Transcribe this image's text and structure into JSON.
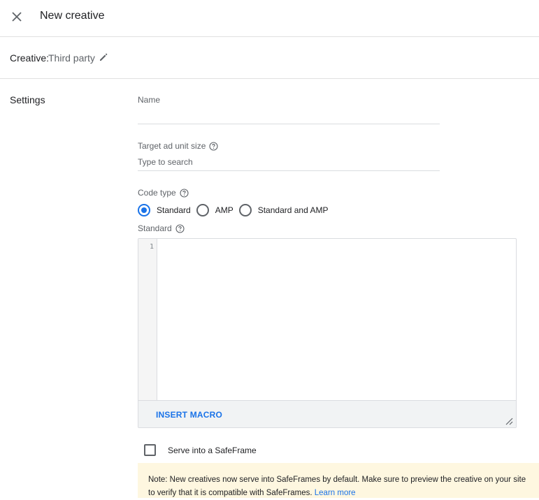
{
  "header": {
    "title": "New creative",
    "close_icon": "close-icon"
  },
  "creative": {
    "label": "Creative:",
    "type": "Third party",
    "edit_icon": "pencil-icon"
  },
  "settings": {
    "section_title": "Settings",
    "name": {
      "label": "Name",
      "value": "",
      "placeholder": ""
    },
    "target_size": {
      "label": "Target ad unit size",
      "value": "",
      "placeholder": "Type to search",
      "help_icon": "help-circle-icon"
    },
    "code_type": {
      "label": "Code type",
      "help_icon": "help-circle-icon",
      "options": [
        "Standard",
        "AMP",
        "Standard and AMP"
      ],
      "selected": "Standard"
    },
    "standard_editor": {
      "label": "Standard",
      "help_icon": "help-circle-icon",
      "line_numbers": [
        "1"
      ],
      "code": "",
      "insert_macro_label": "INSERT MACRO"
    },
    "safeframe": {
      "label": "Serve into a SafeFrame",
      "checked": false
    },
    "note": {
      "text": "Note: New creatives now serve into SafeFrames by default. Make sure to preview the creative on your site to verify that it is compatible with SafeFrames.",
      "link_text": "Learn more"
    }
  },
  "colors": {
    "accent": "#1a73e8",
    "note_bg": "#fef7e0",
    "divider": "#e0e0e0"
  }
}
